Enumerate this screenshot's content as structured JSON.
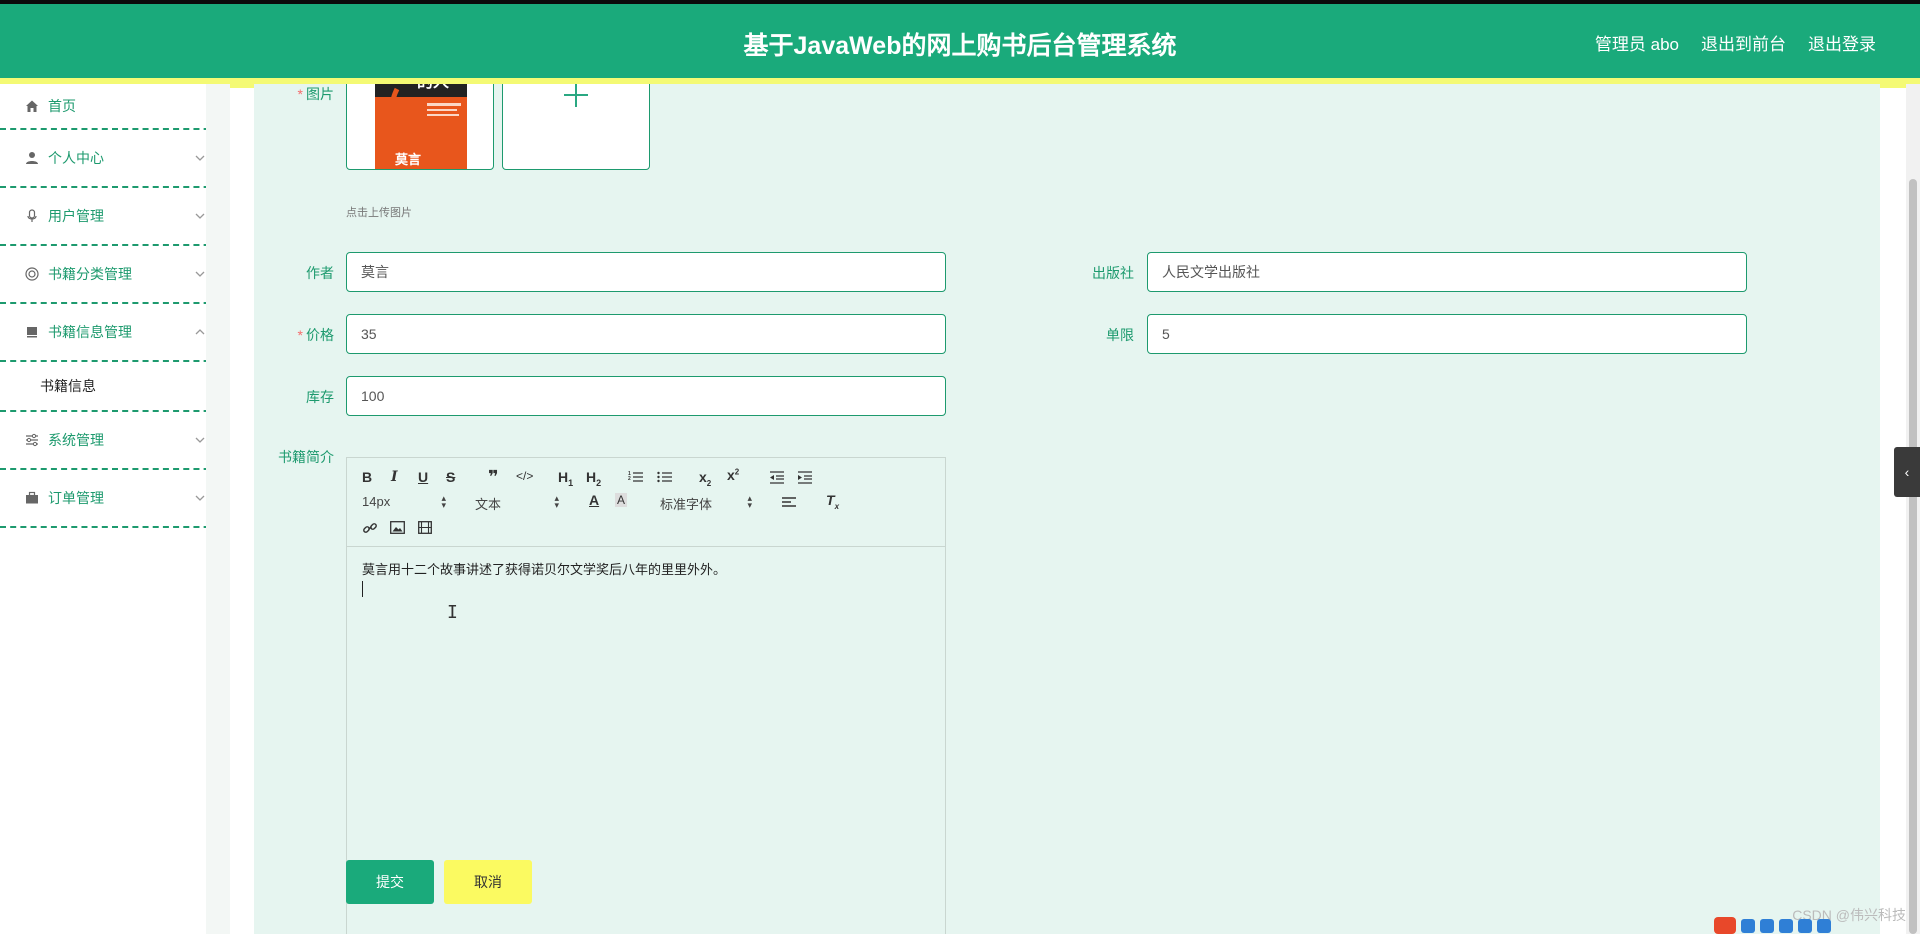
{
  "header": {
    "title": "基于JavaWeb的网上购书后台管理系统",
    "admin_label": "管理员 abo",
    "to_frontend": "退出到前台",
    "logout": "退出登录"
  },
  "sidebar": {
    "items": [
      {
        "label": "首页",
        "icon": "home-icon"
      },
      {
        "label": "个人中心",
        "icon": "user-icon"
      },
      {
        "label": "用户管理",
        "icon": "microphone-icon"
      },
      {
        "label": "书籍分类管理",
        "icon": "circle-icon"
      },
      {
        "label": "书籍信息管理",
        "icon": "book-icon"
      },
      {
        "label": "系统管理",
        "icon": "sliders-icon"
      },
      {
        "label": "订单管理",
        "icon": "briefcase-icon"
      }
    ],
    "submenu": {
      "label": "书籍信息"
    }
  },
  "form": {
    "image_label": "图片",
    "image_hint": "点击上传图片",
    "thumb_text_top": "的人",
    "thumb_text_bottom": "莫言",
    "author_label": "作者",
    "author_value": "莫言",
    "publisher_label": "出版社",
    "publisher_value": "人民文学出版社",
    "price_label": "价格",
    "price_value": "35",
    "limit_label": "单限",
    "limit_value": "5",
    "stock_label": "库存",
    "stock_value": "100",
    "intro_label": "书籍简介"
  },
  "editor": {
    "font_size": "14px",
    "block_type": "文本",
    "font_family": "标准字体",
    "content": "莫言用十二个故事讲述了获得诺贝尔文学奖后八年的里里外外。"
  },
  "buttons": {
    "submit": "提交",
    "cancel": "取消"
  },
  "watermark": "CSDN @伟兴科技",
  "colors": {
    "primary": "#1aaa7b",
    "accent_yellow": "#fbfa61",
    "content_bg": "#e6f5f0",
    "required": "#f56c6c"
  }
}
